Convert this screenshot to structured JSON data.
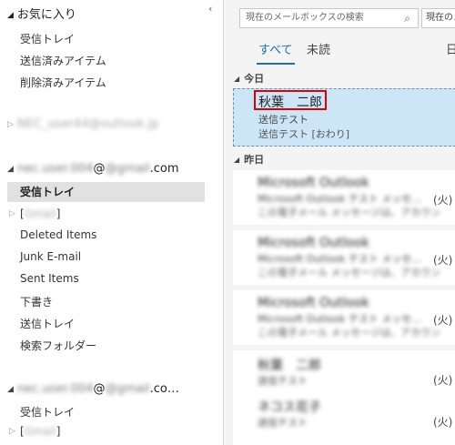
{
  "sidebar": {
    "favorites_title": "お気に入り",
    "collapse_icon": "chevron-left-icon",
    "favorites": [
      "受信トレイ",
      "送信済みアイテム",
      "削除済みアイテム"
    ],
    "account1": {
      "email": "NEC_user44@outlook.jp"
    },
    "account2": {
      "user": "nec.user.004",
      "at_domain": "@gmail",
      "suffix": ".com",
      "selected_folder": "受信トレイ",
      "subfolder_prefix": "[",
      "subfolder_name": "Gmail",
      "subfolder_suffix": "]",
      "folders": [
        "Deleted Items",
        "Junk E-mail",
        "Sent Items",
        "下書き",
        "送信トレイ",
        "検索フォルダー"
      ]
    },
    "account3": {
      "user": "nec.user.004",
      "at_domain": "@gmail",
      "suffix": ".co…",
      "folder": "受信トレイ",
      "subfolder_prefix": "[",
      "subfolder_name": "Gmail",
      "subfolder_suffix": "]"
    }
  },
  "main": {
    "search_placeholder": "現在のメールボックスの検索",
    "search_scope": "現在のメ",
    "tabs": {
      "all": "すべて",
      "unread": "未読",
      "by_date": "日"
    },
    "groups": {
      "today": "今日",
      "yesterday": "昨日"
    },
    "selected_message": {
      "sender": "秋葉　二郎",
      "subject": "送信テスト",
      "preview": "送信テスト [おわり]"
    },
    "messages": [
      {
        "sender": "Microsoft Outlook",
        "subject": "Microsoft Outlook テスト メッセ…",
        "preview": "この電子メール メッセージは、アカウン",
        "day": "(火)"
      },
      {
        "sender": "Microsoft Outlook",
        "subject": "Microsoft Outlook テスト メッセ…",
        "preview": "この電子メール メッセージは、アカウン",
        "day": "(火)"
      },
      {
        "sender": "Microsoft Outlook",
        "subject": "Microsoft Outlook テスト メッセ…",
        "preview": "この電子メール メッセージは、アカウン",
        "day": "(火)"
      },
      {
        "sender": "秋葉　二郎",
        "subject": "送信テスト",
        "preview": "",
        "day": "(火)"
      },
      {
        "sender": "ネコス花子",
        "subject": "送信テスト",
        "preview": "",
        "day": "(火)"
      }
    ],
    "colors": {
      "accent": "#1e6fb8",
      "selection": "#cde6f7",
      "highlight": "#e00000"
    }
  }
}
